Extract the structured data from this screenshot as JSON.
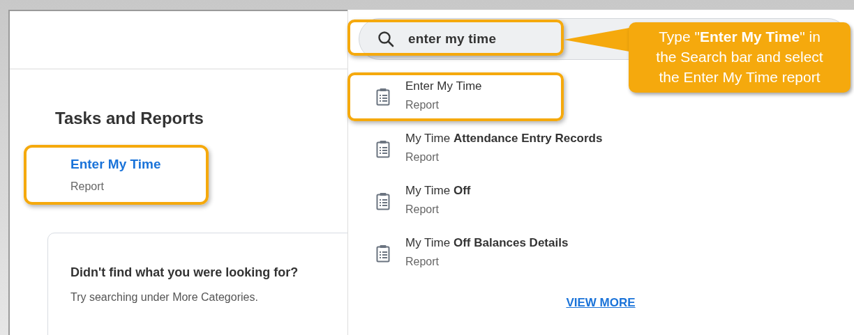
{
  "section": {
    "title": "Tasks and Reports",
    "items": [
      {
        "title": "Enter My Time",
        "type": "Report",
        "highlighted": true
      }
    ]
  },
  "help_card": {
    "title": "Didn't find what you were looking for?",
    "text": "Try searching under More Categories."
  },
  "search": {
    "value": "enter my time",
    "highlighted": true
  },
  "results": [
    {
      "title": "Enter My Time",
      "type": "Report",
      "highlighted": true
    },
    {
      "title": "My Time **Attendance Entry Records**",
      "type": "Report",
      "highlighted": false
    },
    {
      "title": "My Time **Off**",
      "type": "Report",
      "highlighted": false
    },
    {
      "title": "My Time **Off Balances Details**",
      "type": "Report",
      "highlighted": false
    }
  ],
  "view_more": "VIEW MORE",
  "callout": {
    "text": "Type \"**Enter My Time**\" in the Search bar and select the Enter My Time report"
  }
}
